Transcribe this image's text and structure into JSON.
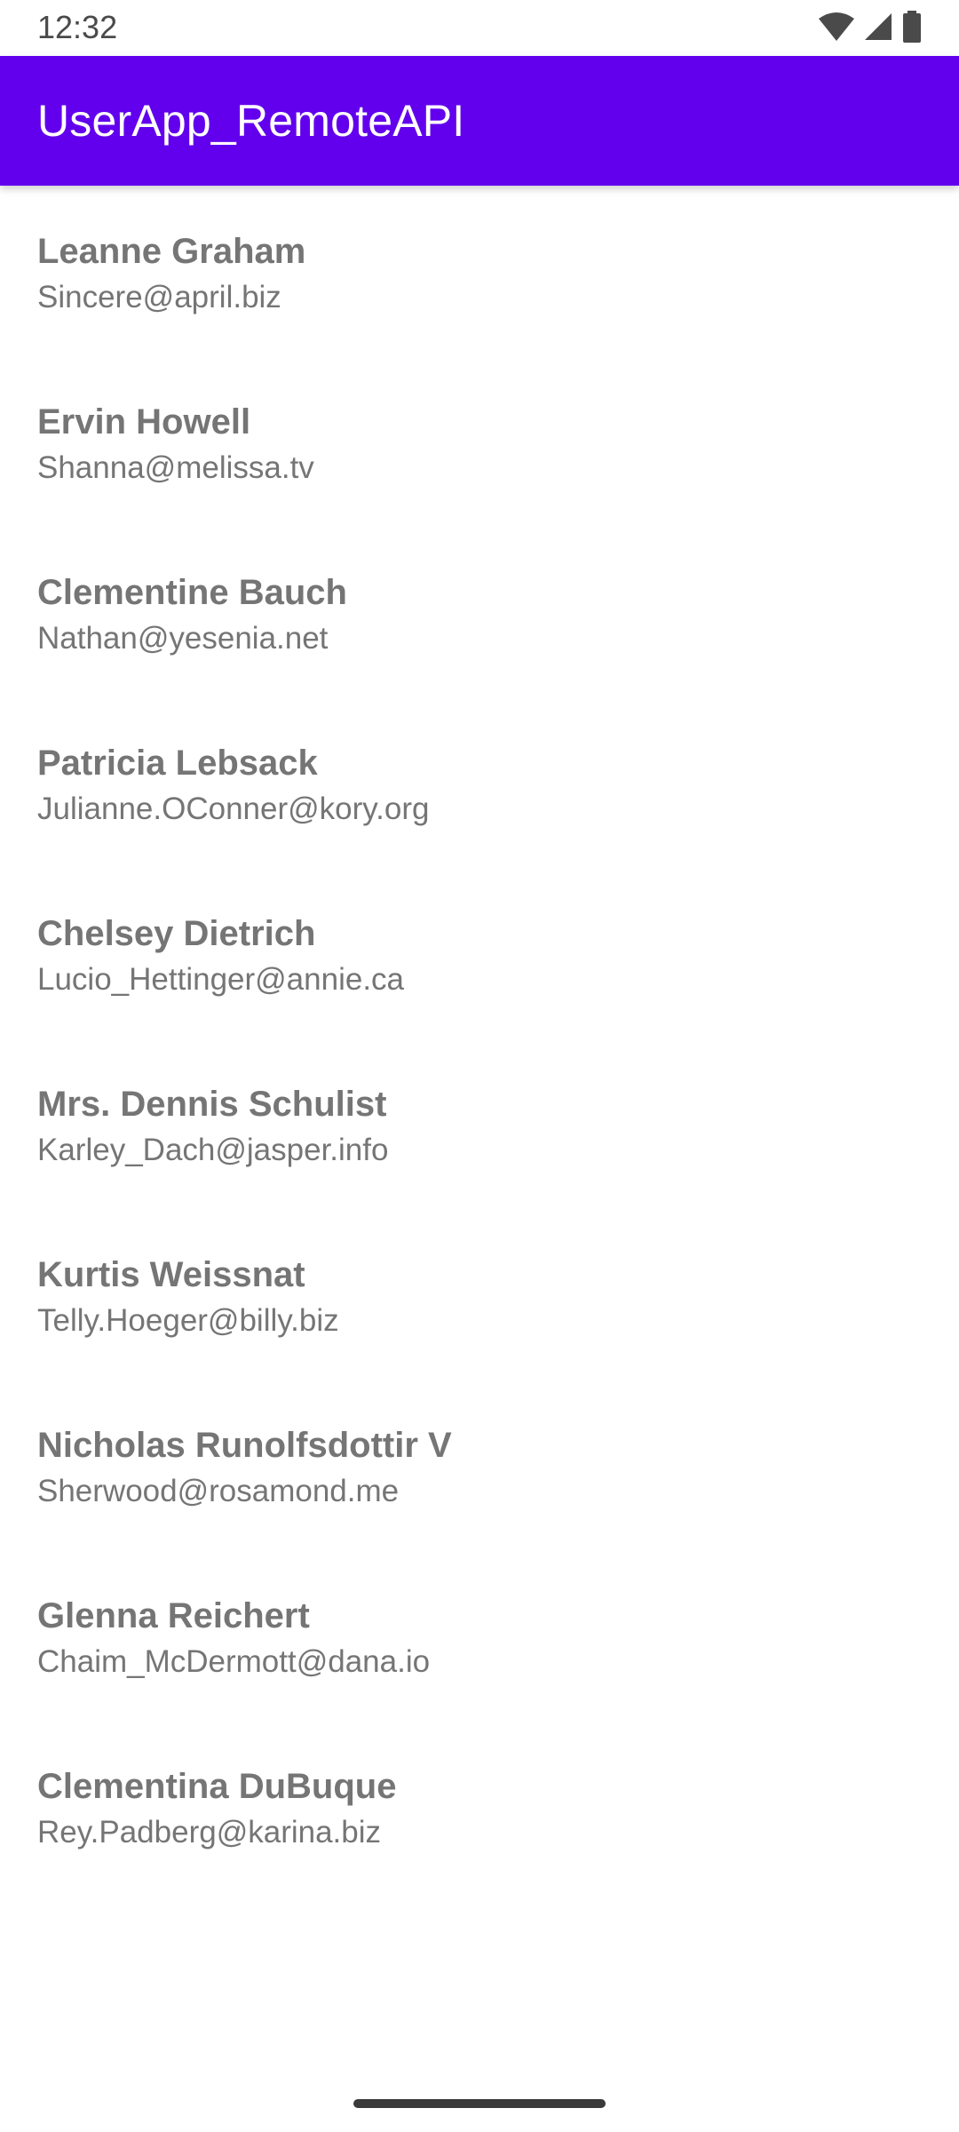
{
  "status_bar": {
    "time": "12:32",
    "icons": [
      "wifi-icon",
      "cellular-signal-icon",
      "battery-icon"
    ]
  },
  "app_bar": {
    "title": "UserApp_RemoteAPI",
    "color": "#6200ee"
  },
  "users": [
    {
      "name": "Leanne Graham",
      "email": "Sincere@april.biz"
    },
    {
      "name": "Ervin Howell",
      "email": "Shanna@melissa.tv"
    },
    {
      "name": "Clementine Bauch",
      "email": "Nathan@yesenia.net"
    },
    {
      "name": "Patricia Lebsack",
      "email": "Julianne.OConner@kory.org"
    },
    {
      "name": "Chelsey Dietrich",
      "email": "Lucio_Hettinger@annie.ca"
    },
    {
      "name": "Mrs. Dennis Schulist",
      "email": "Karley_Dach@jasper.info"
    },
    {
      "name": "Kurtis Weissnat",
      "email": "Telly.Hoeger@billy.biz"
    },
    {
      "name": "Nicholas Runolfsdottir V",
      "email": "Sherwood@rosamond.me"
    },
    {
      "name": "Glenna Reichert",
      "email": "Chaim_McDermott@dana.io"
    },
    {
      "name": "Clementina DuBuque",
      "email": "Rey.Padberg@karina.biz"
    }
  ]
}
